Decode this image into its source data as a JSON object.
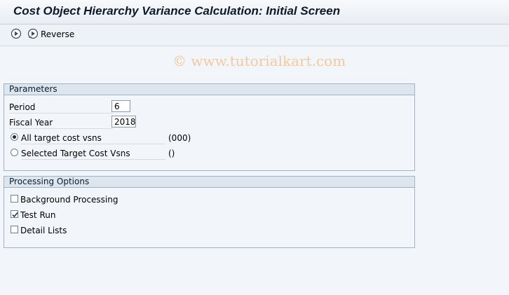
{
  "window": {
    "title": "Cost Object Hierarchy Variance Calculation: Initial Screen"
  },
  "toolbar": {
    "reverse_label": "Reverse"
  },
  "watermark": "© www.tutorialkart.com",
  "parameters": {
    "title": "Parameters",
    "period_label": "Period",
    "period_value": "6",
    "fiscal_year_label": "Fiscal Year",
    "fiscal_year_value": "2018",
    "all_target_label": "All target cost vsns",
    "all_target_value": "(000)",
    "all_target_selected": true,
    "selected_target_label": "Selected Target Cost Vsns",
    "selected_target_value": "()",
    "selected_target_selected": false
  },
  "processing": {
    "title": "Processing Options",
    "background_label": "Background Processing",
    "background_checked": false,
    "test_run_label": "Test Run",
    "test_run_checked": true,
    "detail_lists_label": "Detail Lists",
    "detail_lists_checked": false
  },
  "colors": {
    "accent": "#0e1a2b",
    "group_border": "#9fb3c8",
    "watermark": "#f4c9a2"
  }
}
